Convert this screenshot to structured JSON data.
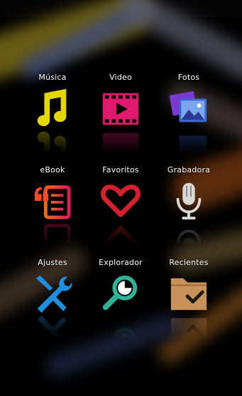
{
  "launcher": {
    "items": [
      {
        "label": "Música",
        "icon": "music-note-icon",
        "color": "#e6d600"
      },
      {
        "label": "Video",
        "icon": "film-strip-icon",
        "color": "#e0196e"
      },
      {
        "label": "Fotos",
        "icon": "photos-icon",
        "color": "#6e4bd8"
      },
      {
        "label": "eBook",
        "icon": "ebook-icon",
        "color": "#f04a1e"
      },
      {
        "label": "Favoritos",
        "icon": "heart-icon",
        "color": "#d6202e"
      },
      {
        "label": "Grabadora",
        "icon": "microphone-icon",
        "color": "#d9d9d9"
      },
      {
        "label": "Ajustes",
        "icon": "wrench-screwdriver-icon",
        "color": "#1c8fe0"
      },
      {
        "label": "Explorador",
        "icon": "search-icon",
        "color": "#2db39a"
      },
      {
        "label": "Recientes",
        "icon": "folder-check-icon",
        "color": "#c8925a"
      }
    ]
  }
}
